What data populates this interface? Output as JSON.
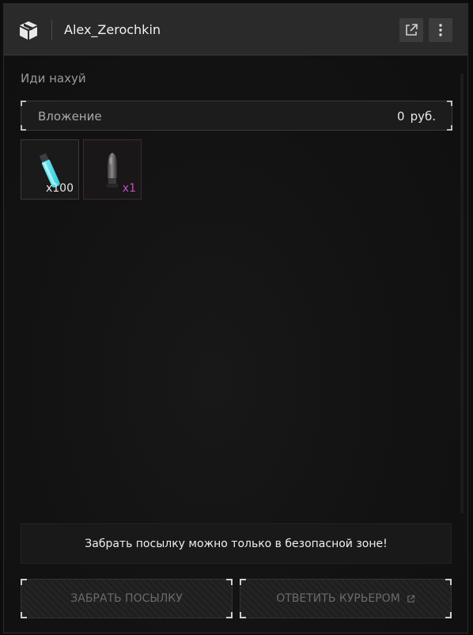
{
  "header": {
    "sender": "Alex_Zerochkin",
    "icons": {
      "package": "package-icon",
      "open_external": "external-link-icon",
      "more": "more-vertical-icon"
    }
  },
  "message": {
    "subject": "Иди нахуй"
  },
  "attachment": {
    "label": "Вложение",
    "amount": "0",
    "currency": "руб."
  },
  "items": [
    {
      "name": "glowstick",
      "quantity": "x100",
      "qty_color": "#e6e6e6"
    },
    {
      "name": "grenade",
      "quantity": "x1",
      "qty_color": "#c64fc0"
    }
  ],
  "notice": "Забрать посылку можно только в безопасной зоне!",
  "buttons": {
    "take": "ЗАБРАТЬ ПОСЫЛКУ",
    "reply": "ОТВЕТИТЬ КУРЬЕРОМ"
  }
}
